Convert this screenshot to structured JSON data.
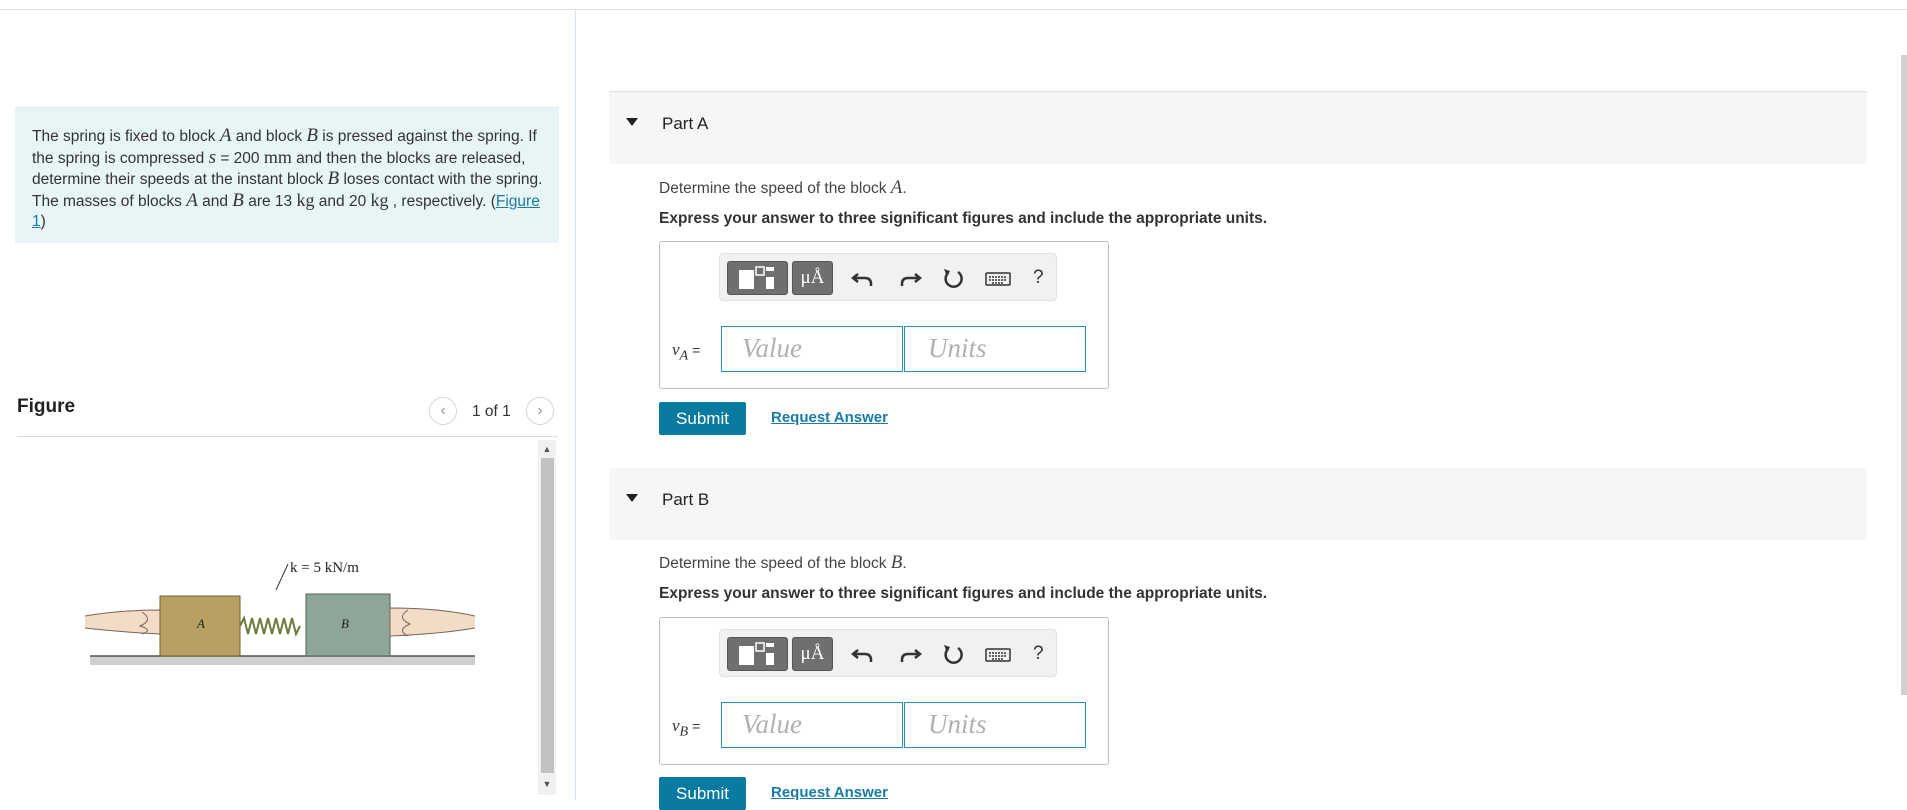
{
  "problem": {
    "t1": "The spring is fixed to block ",
    "A1": "A",
    "t2": " and block ",
    "B1": "B",
    "t3": " is pressed against the spring. If the spring is compressed ",
    "s": "s",
    "t4": " = 200 ",
    "mm": "mm",
    "t5": " and then the blocks are released, determine their speeds at the instant block ",
    "B2": "B",
    "t6": " loses contact with the spring. The masses of blocks ",
    "A2": "A",
    "t7": " and ",
    "B3": "B",
    "t8": " are 13 ",
    "kg1": "kg",
    "t9": " and 20 ",
    "kg2": "kg",
    "t10": " , respectively. (",
    "fig_link": "Figure 1",
    "t11": ")"
  },
  "figure": {
    "title": "Figure",
    "pager": "1 of 1",
    "spring_label": "k = 5 kN/m",
    "block_a": "A",
    "block_b": "B"
  },
  "partA": {
    "title": "Part A",
    "q_text": "Determine the speed of the block ",
    "q_var": "A",
    "q_end": ".",
    "instruction": "Express your answer to three significant figures and include the appropriate units.",
    "mu_label": "μÅ",
    "help": "?",
    "var_main": "v",
    "var_sub": "A",
    "eq": " =",
    "value_placeholder": "Value",
    "units_placeholder": "Units",
    "submit": "Submit",
    "request": "Request Answer"
  },
  "partB": {
    "title": "Part B",
    "q_text": "Determine the speed of the block ",
    "q_var": "B",
    "q_end": ".",
    "instruction": "Express your answer to three significant figures and include the appropriate units.",
    "mu_label": "μÅ",
    "help": "?",
    "var_main": "v",
    "var_sub": "B",
    "eq": " =",
    "value_placeholder": "Value",
    "units_placeholder": "Units",
    "submit": "Submit",
    "request": "Request Answer"
  },
  "colors": {
    "accent": "#0a7ba0",
    "link": "#1a7ca6",
    "problem_bg": "#e8f5f6",
    "block_a": "#b8a063",
    "block_b": "#8fa597"
  },
  "icons": [
    "template-icon",
    "undo-icon",
    "redo-icon",
    "reset-icon",
    "keyboard-icon",
    "help-icon",
    "chevron-left-icon",
    "chevron-right-icon",
    "caret-down-icon"
  ]
}
